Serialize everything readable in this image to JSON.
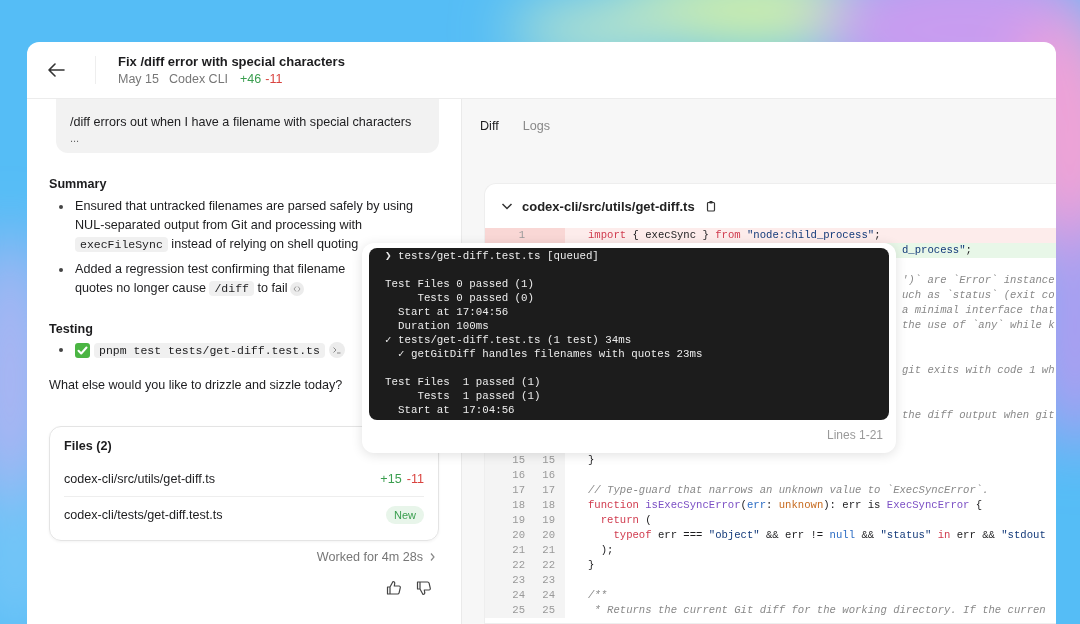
{
  "header": {
    "title": "Fix /diff error with special characters",
    "date": "May 15",
    "source": "Codex CLI",
    "added": "+46",
    "removed": "-11"
  },
  "message": {
    "text": "/diff errors out when I have a filename with special characters",
    "more": "..."
  },
  "summary": {
    "heading": "Summary",
    "items": [
      {
        "lines": [
          [
            {
              "kind": "text",
              "text": "Ensured that untracked filenames are parsed safely by using"
            }
          ],
          [
            {
              "kind": "text",
              "text": "NUL-separated output from Git and processing with"
            }
          ],
          [
            {
              "kind": "code",
              "text": "execFileSync"
            },
            {
              "kind": "text",
              "text": " instead of relying on shell quoting"
            }
          ]
        ]
      },
      {
        "lines": [
          [
            {
              "kind": "text",
              "text": "Added a regression test confirming that filename"
            }
          ],
          [
            {
              "kind": "text",
              "text": "quotes no longer cause "
            },
            {
              "kind": "code",
              "text": "/diff"
            },
            {
              "kind": "text",
              "text": " to fail"
            },
            {
              "kind": "citation"
            }
          ]
        ]
      }
    ]
  },
  "testing": {
    "heading": "Testing",
    "items": [
      {
        "passed": true,
        "command": "pnpm test tests/get-diff.test.ts"
      }
    ]
  },
  "closing": "What else would you like to drizzle and sizzle today?",
  "files": {
    "title": "Files (2)",
    "rows": [
      {
        "kind": "changed",
        "path": "codex-cli/src/utils/get-diff.ts",
        "added": "+15",
        "removed": "-11"
      },
      {
        "kind": "new",
        "path": "codex-cli/tests/get-diff.test.ts",
        "badge": "New"
      }
    ]
  },
  "worked": "Worked for 4m 28s",
  "tabs": [
    {
      "label": "Diff",
      "selected": true
    },
    {
      "label": "Logs",
      "selected": false
    }
  ],
  "diff": {
    "file": "codex-cli/src/utils/get-diff.ts",
    "expanded": true,
    "lines": [
      {
        "kind": "deleted",
        "old": "1",
        "tokens": [
          {
            "kind": "keyword",
            "text": "import"
          },
          {
            "kind": "plain",
            "text": " { execSync } "
          },
          {
            "kind": "keyword",
            "text": "from"
          },
          {
            "kind": "string",
            "text": " \"node:child_process\""
          },
          {
            "kind": "plain",
            "text": ";"
          }
        ]
      },
      {
        "kind": "added",
        "covered": true,
        "tokens": [
          {
            "kind": "string",
            "text": "d_process\""
          },
          {
            "kind": "plain",
            "text": ";"
          }
        ]
      },
      {
        "kind": "context"
      },
      {
        "kind": "context",
        "covered": true,
        "tokens": [
          {
            "kind": "comment",
            "text": "')` are `Error` instance"
          }
        ]
      },
      {
        "kind": "context",
        "covered": true,
        "tokens": [
          {
            "kind": "comment",
            "text": "uch as `status` (exit co"
          }
        ]
      },
      {
        "kind": "context",
        "covered": true,
        "tokens": [
          {
            "kind": "comment",
            "text": "a minimal interface that"
          }
        ]
      },
      {
        "kind": "context",
        "covered": true,
        "tokens": [
          {
            "kind": "comment",
            "text": "the use of `any` while k"
          }
        ]
      },
      {
        "kind": "context"
      },
      {
        "kind": "context"
      },
      {
        "kind": "context",
        "covered": true,
        "tokens": [
          {
            "kind": "comment",
            "text": "git exits with code 1 wh"
          }
        ]
      },
      {
        "kind": "context"
      },
      {
        "kind": "context"
      },
      {
        "kind": "context",
        "covered": true,
        "tokens": [
          {
            "kind": "comment",
            "text": "the diff output when git"
          }
        ]
      },
      {
        "kind": "context"
      },
      {
        "kind": "context"
      },
      {
        "kind": "context",
        "old": "15",
        "new": "15",
        "tokens": [
          {
            "kind": "plain",
            "text": "}"
          }
        ]
      },
      {
        "kind": "context",
        "old": "16",
        "new": "16"
      },
      {
        "kind": "context",
        "old": "17",
        "new": "17",
        "tokens": [
          {
            "kind": "comment",
            "text": "// Type-guard that narrows an unknown value to `ExecSyncError`."
          }
        ]
      },
      {
        "kind": "context",
        "old": "18",
        "new": "18",
        "tokens": [
          {
            "kind": "keyword",
            "text": "function"
          },
          {
            "kind": "fn",
            "text": " isExecSyncError"
          },
          {
            "kind": "plain",
            "text": "("
          },
          {
            "kind": "param",
            "text": "err"
          },
          {
            "kind": "plain",
            "text": ": "
          },
          {
            "kind": "builtin",
            "text": "unknown"
          },
          {
            "kind": "plain",
            "text": "): err is "
          },
          {
            "kind": "fn",
            "text": "ExecSyncError"
          },
          {
            "kind": "plain",
            "text": " {"
          }
        ]
      },
      {
        "kind": "context",
        "old": "19",
        "new": "19",
        "tokens": [
          {
            "kind": "keyword",
            "text": "  return"
          },
          {
            "kind": "plain",
            "text": " ("
          }
        ]
      },
      {
        "kind": "context",
        "old": "20",
        "new": "20",
        "tokens": [
          {
            "kind": "keyword",
            "text": "    typeof"
          },
          {
            "kind": "plain",
            "text": " err === "
          },
          {
            "kind": "string",
            "text": "\"object\""
          },
          {
            "kind": "plain",
            "text": " && err != "
          },
          {
            "kind": "constant",
            "text": "null"
          },
          {
            "kind": "plain",
            "text": " && "
          },
          {
            "kind": "string",
            "text": "\"status\""
          },
          {
            "kind": "keyword",
            "text": " in"
          },
          {
            "kind": "plain",
            "text": " err && "
          },
          {
            "kind": "string",
            "text": "\"stdout"
          }
        ]
      },
      {
        "kind": "context",
        "old": "21",
        "new": "21",
        "tokens": [
          {
            "kind": "plain",
            "text": "  );"
          }
        ]
      },
      {
        "kind": "context",
        "old": "22",
        "new": "22",
        "tokens": [
          {
            "kind": "plain",
            "text": "}"
          }
        ]
      },
      {
        "kind": "context",
        "old": "23",
        "new": "23"
      },
      {
        "kind": "context",
        "old": "24",
        "new": "24",
        "tokens": [
          {
            "kind": "comment",
            "text": "/**"
          }
        ]
      },
      {
        "kind": "context",
        "old": "25",
        "new": "25",
        "tokens": [
          {
            "kind": "comment",
            "text": " * Returns the current Git diff for the working directory. If the curren"
          }
        ]
      }
    ]
  },
  "terminal": {
    "blocks": [
      [
        "❯ tests/get-diff.test.ts [queued]"
      ],
      [
        "Test Files 0 passed (1)",
        "     Tests 0 passed (0)",
        "  Start at 17:04:56",
        "  Duration 100ms",
        "✓ tests/get-diff.test.ts (1 test) 34ms",
        "  ✓ getGitDiff handles filenames with quotes 23ms"
      ],
      [
        "Test Files  1 passed (1)",
        "     Tests  1 passed (1)",
        "  Start at  17:04:56"
      ]
    ],
    "footer": "Lines 1-21"
  }
}
